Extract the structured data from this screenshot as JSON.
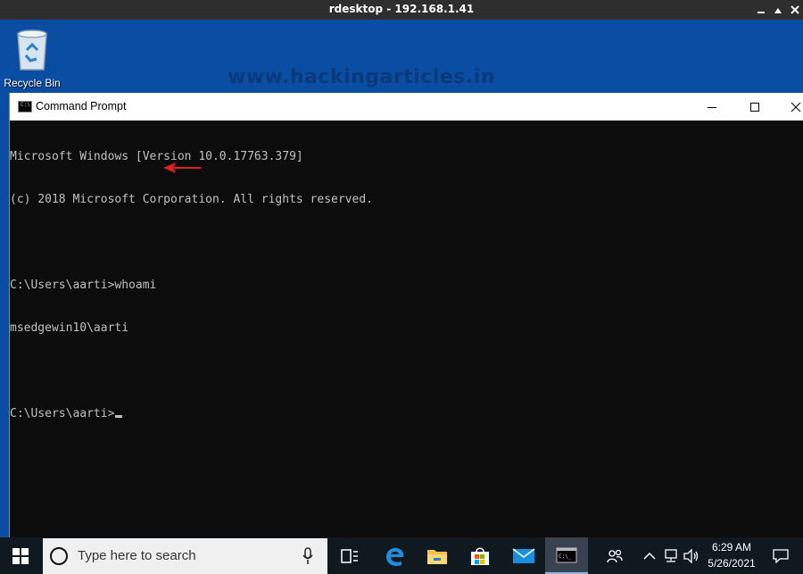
{
  "rdesktop": {
    "title": "rdesktop - 192.168.1.41"
  },
  "desktop": {
    "recycle_bin_label": "Recycle Bin",
    "watermark": "www.hackingarticles.in"
  },
  "cmd_window": {
    "title": "Command Prompt",
    "lines": [
      "Microsoft Windows [Version 10.0.17763.379]",
      "(c) 2018 Microsoft Corporation. All rights reserved.",
      "",
      "C:\\Users\\aarti>whoami",
      "msedgewin10\\aarti",
      "",
      "C:\\Users\\aarti>"
    ],
    "annotation": "red-arrow-icon"
  },
  "taskbar": {
    "search_placeholder": "Type here to search",
    "time": "6:29 AM",
    "date": "5/26/2021",
    "icons": [
      "windows-start-icon",
      "search-icon",
      "microphone-icon",
      "task-view-icon",
      "edge-icon",
      "file-explorer-icon",
      "store-icon",
      "mail-icon",
      "command-prompt-icon",
      "people-icon",
      "chevron-up-icon",
      "network-icon",
      "volume-icon",
      "notification-icon"
    ]
  },
  "colors": {
    "desktop_bg": "#0a4ea3",
    "console_bg": "#0c0c0c",
    "console_text": "#c0c0c0",
    "arrow": "#e02020",
    "taskbar_bg": "#101820"
  }
}
